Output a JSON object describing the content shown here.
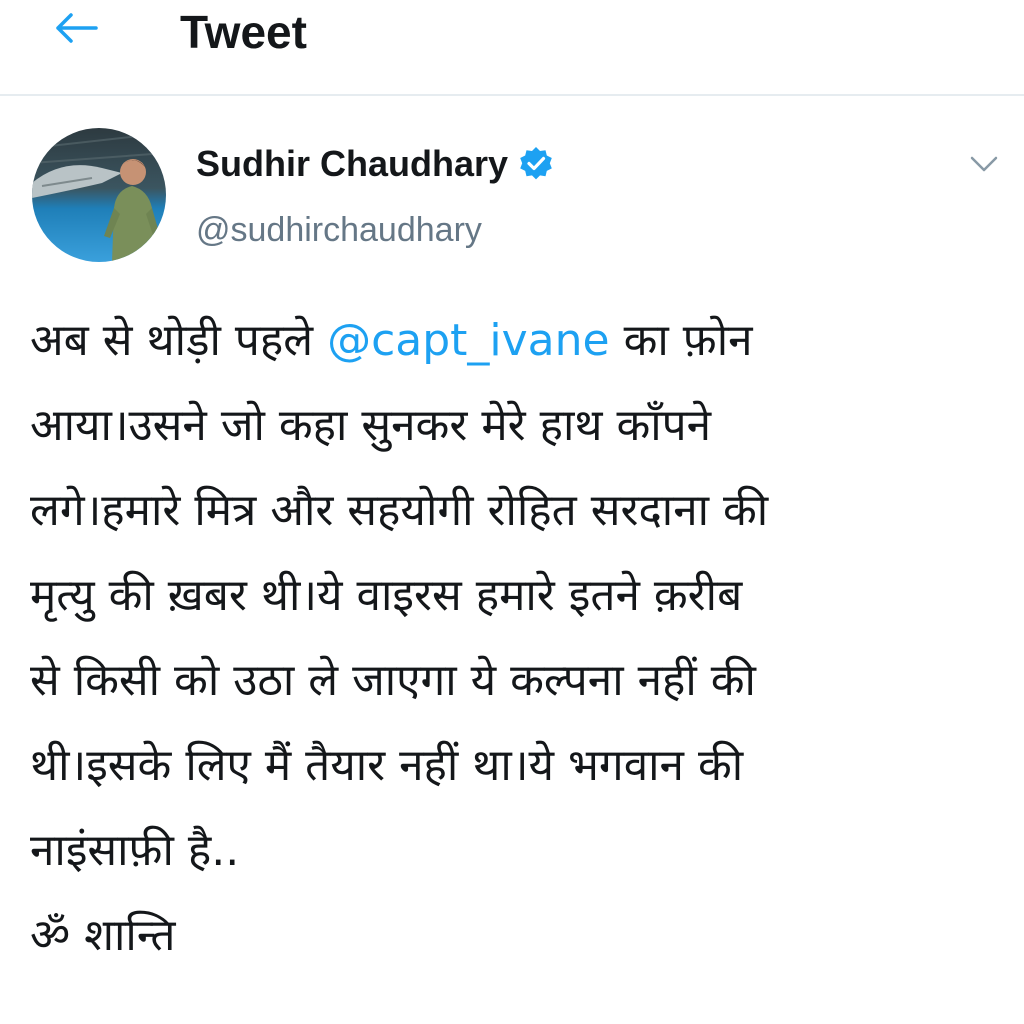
{
  "header": {
    "title": "Tweet",
    "back_icon": "arrow-left-icon"
  },
  "author": {
    "name": "Sudhir Chaudhary",
    "handle": "@sudhirchaudhary",
    "verified_icon": "verified-badge-icon",
    "menu_icon": "chevron-down-icon"
  },
  "tweet": {
    "lines": [
      {
        "before": "अब से थोड़ी पहले ",
        "mention": "@capt_ivane",
        "after": " का फ़ोन"
      },
      {
        "text": "आया।उसने जो कहा सुनकर मेरे हाथ काँपने"
      },
      {
        "text": "लगे।हमारे मित्र और सहयोगी रोहित सरदाना की"
      },
      {
        "text": "मृत्यु की ख़बर थी।ये वाइरस हमारे इतने क़रीब"
      },
      {
        "text": "से किसी को उठा ले जाएगा ये कल्पना नहीं की"
      },
      {
        "text": "थी।इसके लिए मैं तैयार नहीं था।ये भगवान की"
      },
      {
        "text": "नाइंसाफ़ी है.."
      },
      {
        "text": "ॐ शान्ति"
      }
    ]
  },
  "colors": {
    "accent": "#1da1f2",
    "text_primary": "#14171a",
    "text_secondary": "#657786",
    "divider": "#e6ecf0"
  }
}
